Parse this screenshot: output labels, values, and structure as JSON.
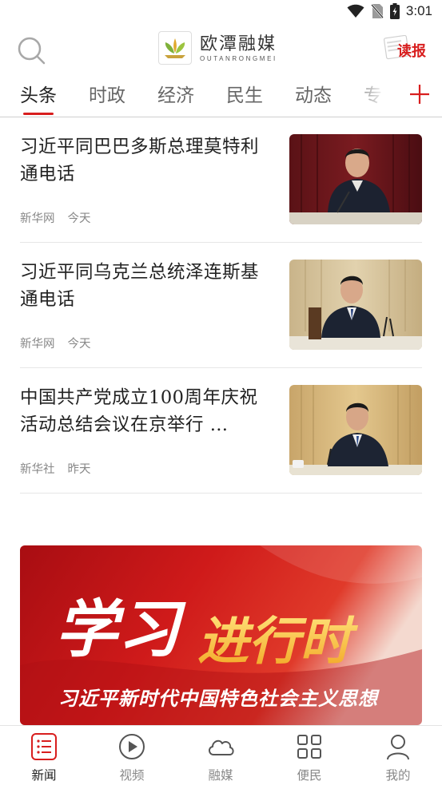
{
  "status_bar": {
    "time": "3:01",
    "icons": [
      "wifi-icon",
      "no-sim-icon",
      "battery-icon"
    ]
  },
  "header": {
    "logo_cn": "欧潭融媒",
    "logo_en": "OUTANRONGMEI",
    "dubao_label": "读报",
    "accent_color": "#d81e1e"
  },
  "tabs": [
    {
      "label": "头条",
      "active": true
    },
    {
      "label": "时政"
    },
    {
      "label": "经济"
    },
    {
      "label": "民生"
    },
    {
      "label": "动态"
    },
    {
      "label": "专"
    }
  ],
  "news": [
    {
      "title": "习近平同巴巴多斯总理莫特利通电话",
      "source": "新华网",
      "time": "今天"
    },
    {
      "title": "习近平同乌克兰总统泽连斯基通电话",
      "source": "新华网",
      "time": "今天"
    },
    {
      "title": "中国共产党成立100周年庆祝活动总结会议在京举行 …",
      "source": "新华社",
      "time": "昨天"
    }
  ],
  "banner": {
    "title_white": "学习",
    "title_gold": "进行时",
    "subtitle": "习近平新时代中国特色社会主义思想"
  },
  "bottom_nav": [
    {
      "label": "新闻",
      "icon": "news-list-icon",
      "active": true
    },
    {
      "label": "视频",
      "icon": "play-circle-icon"
    },
    {
      "label": "融媒",
      "icon": "cloud-icon"
    },
    {
      "label": "便民",
      "icon": "grid-apps-icon"
    },
    {
      "label": "我的",
      "icon": "user-icon"
    }
  ]
}
